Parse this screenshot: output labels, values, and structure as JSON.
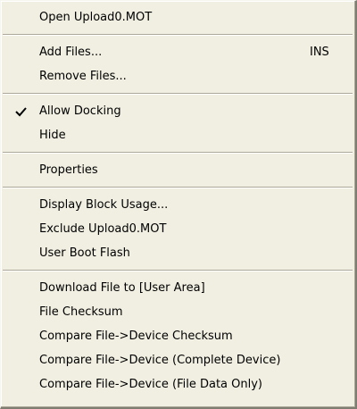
{
  "menu": {
    "items": [
      {
        "label": "Open Upload0.MOT"
      },
      {
        "label": "Add Files...",
        "shortcut": "INS"
      },
      {
        "label": "Remove Files..."
      },
      {
        "label": "Allow Docking",
        "checked": true
      },
      {
        "label": "Hide"
      },
      {
        "label": "Properties"
      },
      {
        "label": "Display Block Usage..."
      },
      {
        "label": "Exclude Upload0.MOT"
      },
      {
        "label": "User Boot Flash"
      },
      {
        "label": "Download File to [User Area]"
      },
      {
        "label": "File Checksum"
      },
      {
        "label": "Compare File->Device Checksum"
      },
      {
        "label": "Compare File->Device (Complete Device)"
      },
      {
        "label": "Compare File->Device (File Data Only)"
      }
    ]
  },
  "colors": {
    "menu_background": "#f1efe2",
    "separator_shadow": "#aca899",
    "text": "#000000"
  },
  "icons": {
    "check": "checkmark-icon"
  }
}
